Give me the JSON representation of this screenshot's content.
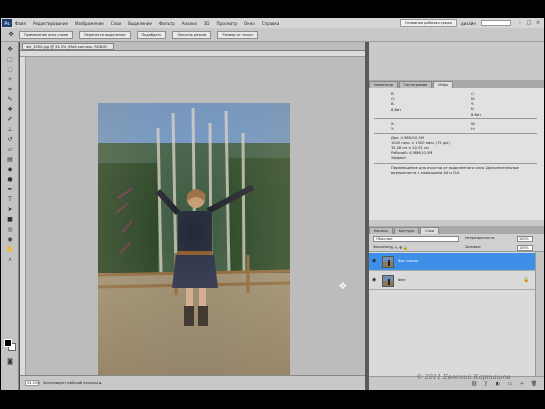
{
  "app": {
    "logo": "Ps",
    "workspace_button": "Основная рабочая среда",
    "design_label": "дизайн",
    "window_controls": [
      "minimize-icon",
      "restore-icon",
      "close-icon"
    ]
  },
  "menu": [
    "Файл",
    "Редактирование",
    "Изображение",
    "Слои",
    "Выделение",
    "Фильтр",
    "Анализ",
    "3D",
    "Просмотр",
    "Окно",
    "Справка"
  ],
  "options": [
    "Применение всех слоев",
    "Перенести выделение",
    "Подобрать",
    "Пиксель режим",
    "Размер от точки"
  ],
  "document": {
    "tab_title": "ole_1000.jpg @ 33.3% (Мой коллаж, RGB/8)",
    "zoom": "33.33%",
    "status_text": "Экспонирует рабочий посылка ►"
  },
  "panels": {
    "top_tabs": [
      "Навигатор",
      "Гистограмма",
      "Инфо"
    ],
    "info": {
      "values": [
        "R:",
        "G:",
        "B:",
        "8-бит",
        "C:",
        "M:",
        "Y:",
        "K:",
        "8-бит",
        "X:",
        "Y:",
        "W:",
        "H:"
      ],
      "doc_lines": [
        "Док: 4,98М/10,5М",
        "1000 пикс × 1500 пикс (72 ppi)",
        "35,28 см × 52,92 см",
        "Рабочий: 4,98М/10,5М",
        "Эффект"
      ],
      "hint": "Перемещение для очистки от выделенного слоя. Дополнительные возможности с клавишами Alt и Ctrl."
    },
    "layers": {
      "tabs": [
        "Каналы",
        "Контуры",
        "Слои"
      ],
      "blend_mode": "Обычные",
      "opacity_label": "Непрозрачность:",
      "opacity_value": "100%",
      "lock_label": "Закрепить:",
      "fill_label": "Заливка:",
      "fill_value": "100%",
      "rows": [
        {
          "name": "Фон копия",
          "selected": true
        },
        {
          "name": "Фон",
          "selected": false
        }
      ]
    }
  },
  "watermark": "© 2011 Евгений Карташов"
}
